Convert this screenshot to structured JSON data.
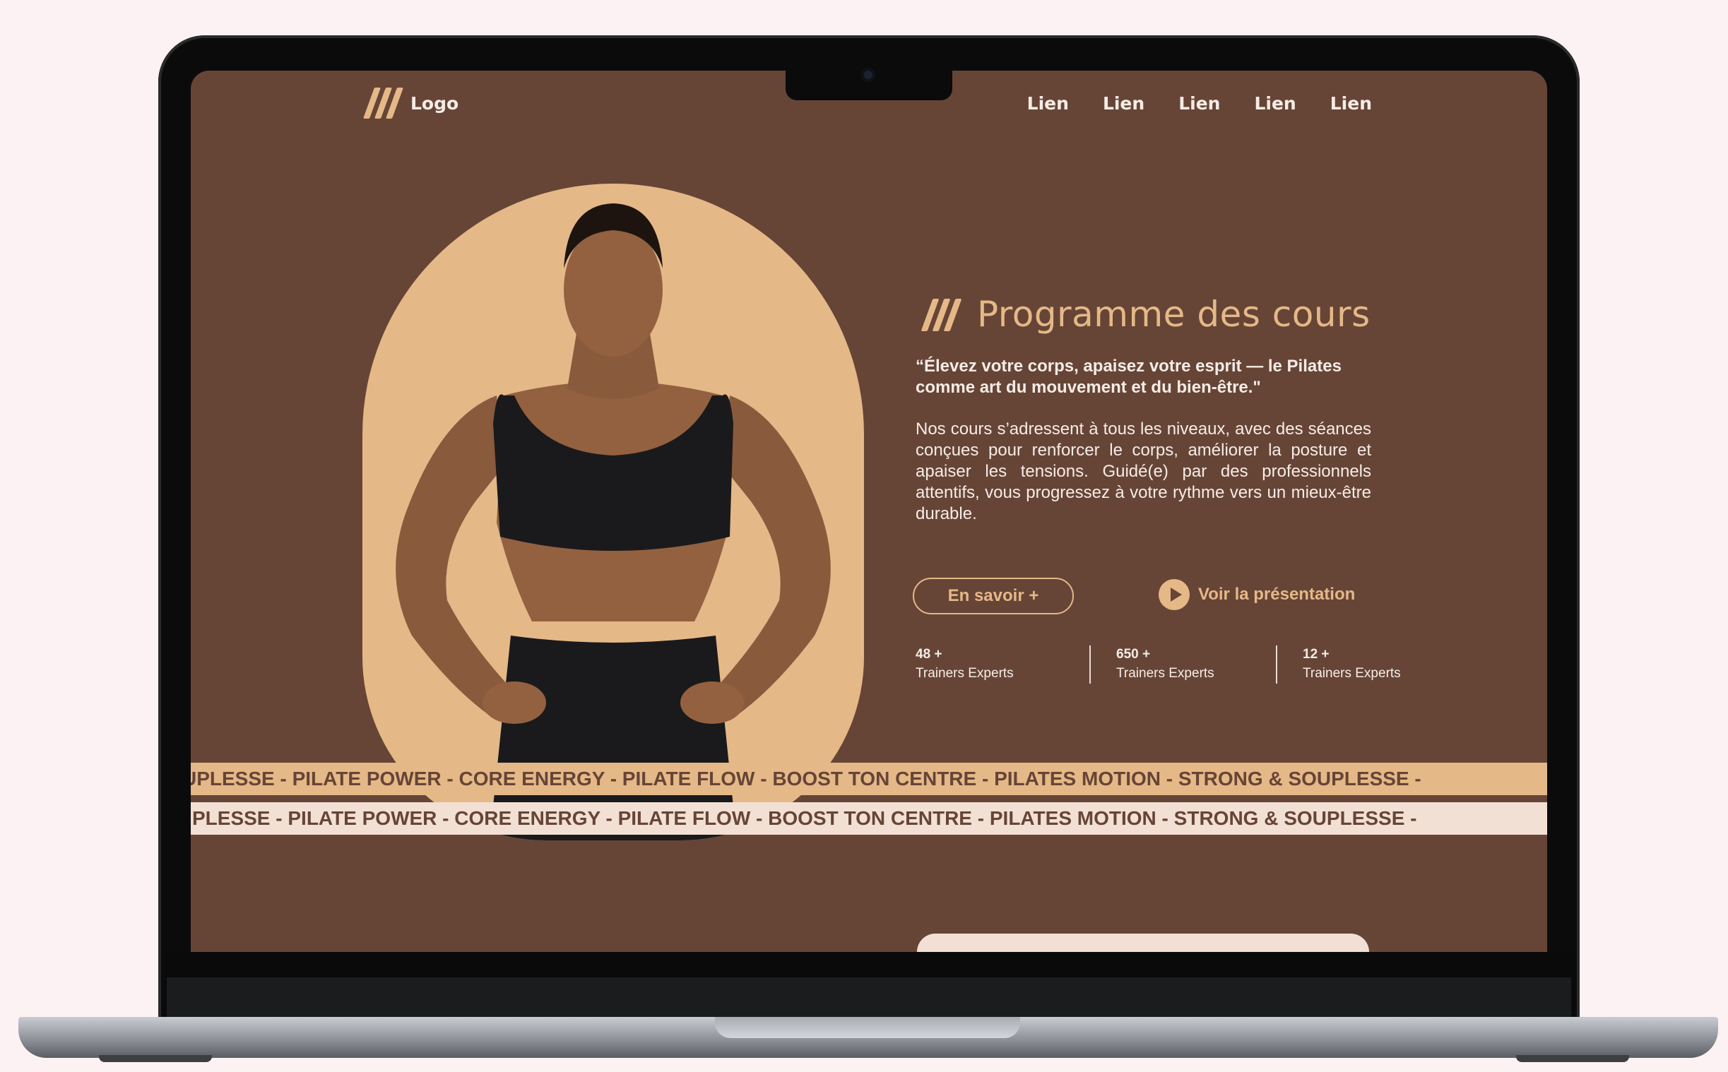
{
  "header": {
    "logo_text": "Logo",
    "nav_links": [
      "Lien",
      "Lien",
      "Lien",
      "Lien",
      "Lien"
    ]
  },
  "hero": {
    "title": "Programme des cours",
    "quote": "“Élevez votre corps, apaisez votre esprit — le Pilates comme art du mouvement et du bien-être.\"",
    "body": "Nos cours s’adressent à tous les niveaux, avec des séances conçues pour renforcer le corps, améliorer la posture et apaiser les tensions. Guidé(e) par des professionnels attentifs, vous progressez à votre rythme vers un mieux-être durable.",
    "button_more": "En savoir +",
    "button_video": "Voir la présentation",
    "image_alt": "Woman in black sports bra with hands on hips",
    "stats": [
      {
        "value": "48 +",
        "label": "Trainers Experts"
      },
      {
        "value": "650 +",
        "label": "Trainers Experts"
      },
      {
        "value": "12 +",
        "label": "Trainers Experts"
      }
    ]
  },
  "marquee": {
    "line1": "UPLESSE - PILATE POWER - CORE ENERGY - PILATE FLOW - BOOST TON CENTRE - PILATES MOTION - STRONG & SOUPLESSE -",
    "line2": "PLESSE - PILATE POWER - CORE ENERGY - PILATE FLOW - BOOST TON CENTRE - PILATES MOTION - STRONG & SOUPLESSE -"
  },
  "colors": {
    "background": "#664537",
    "accent": "#e5b887",
    "light": "#f3e0d4",
    "text": "#f6ece6"
  }
}
